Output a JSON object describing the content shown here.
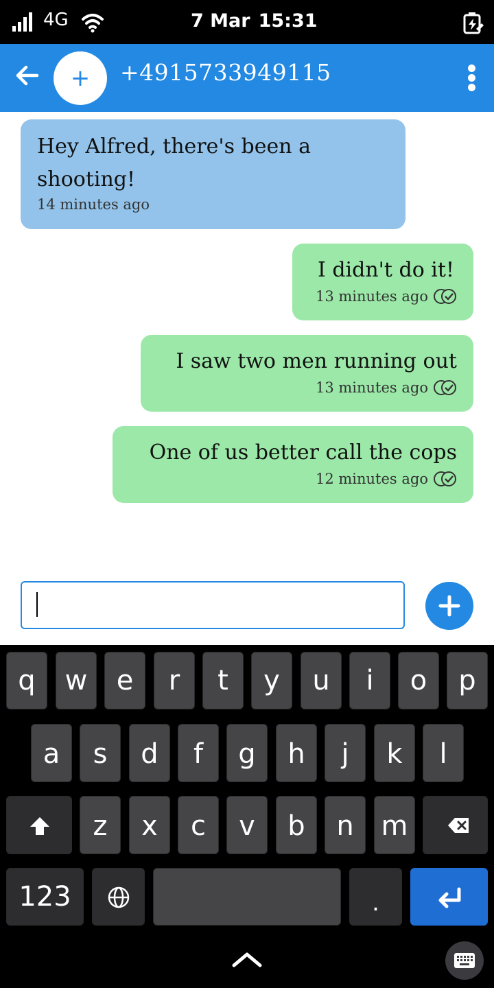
{
  "status_bar": {
    "network": "4G",
    "date": "7 Mar",
    "time": "15:31",
    "icons": [
      "signal-icon",
      "wifi-icon",
      "battery-charging-icon"
    ]
  },
  "header": {
    "contact": "+4915733949115",
    "avatar_symbol": "+",
    "icons": [
      "back-arrow-icon",
      "more-vert-icon"
    ],
    "color": "#2389e2"
  },
  "messages": [
    {
      "direction": "incoming",
      "text": "Hey Alfred, there's been a shooting!",
      "time": "14 minutes ago"
    },
    {
      "direction": "outgoing",
      "text": "I didn't do it!",
      "time": "13 minutes ago",
      "status_icon": "delivered-check-icon"
    },
    {
      "direction": "outgoing",
      "text": "I saw two men running out",
      "time": "13 minutes ago",
      "status_icon": "delivered-check-icon"
    },
    {
      "direction": "outgoing",
      "text": "One of us better call the cops",
      "time": "12 minutes ago",
      "status_icon": "delivered-check-icon"
    }
  ],
  "composer": {
    "value": "",
    "send_icon": "plus-icon"
  },
  "keyboard": {
    "row1": [
      "q",
      "w",
      "e",
      "r",
      "t",
      "y",
      "u",
      "i",
      "o",
      "p"
    ],
    "row2": [
      "a",
      "s",
      "d",
      "f",
      "g",
      "h",
      "j",
      "k",
      "l"
    ],
    "row3": [
      "z",
      "x",
      "c",
      "v",
      "b",
      "n",
      "m"
    ],
    "numbers_key": "123",
    "period_key": ".",
    "icons": [
      "shift-icon",
      "backspace-icon",
      "globe-icon",
      "enter-icon",
      "chevron-up-icon",
      "keyboard-icon"
    ]
  },
  "colors": {
    "incoming_bubble": "#93c3ea",
    "outgoing_bubble": "#9be8a8",
    "accent": "#2389e2",
    "enter_key": "#1f6ed4"
  }
}
